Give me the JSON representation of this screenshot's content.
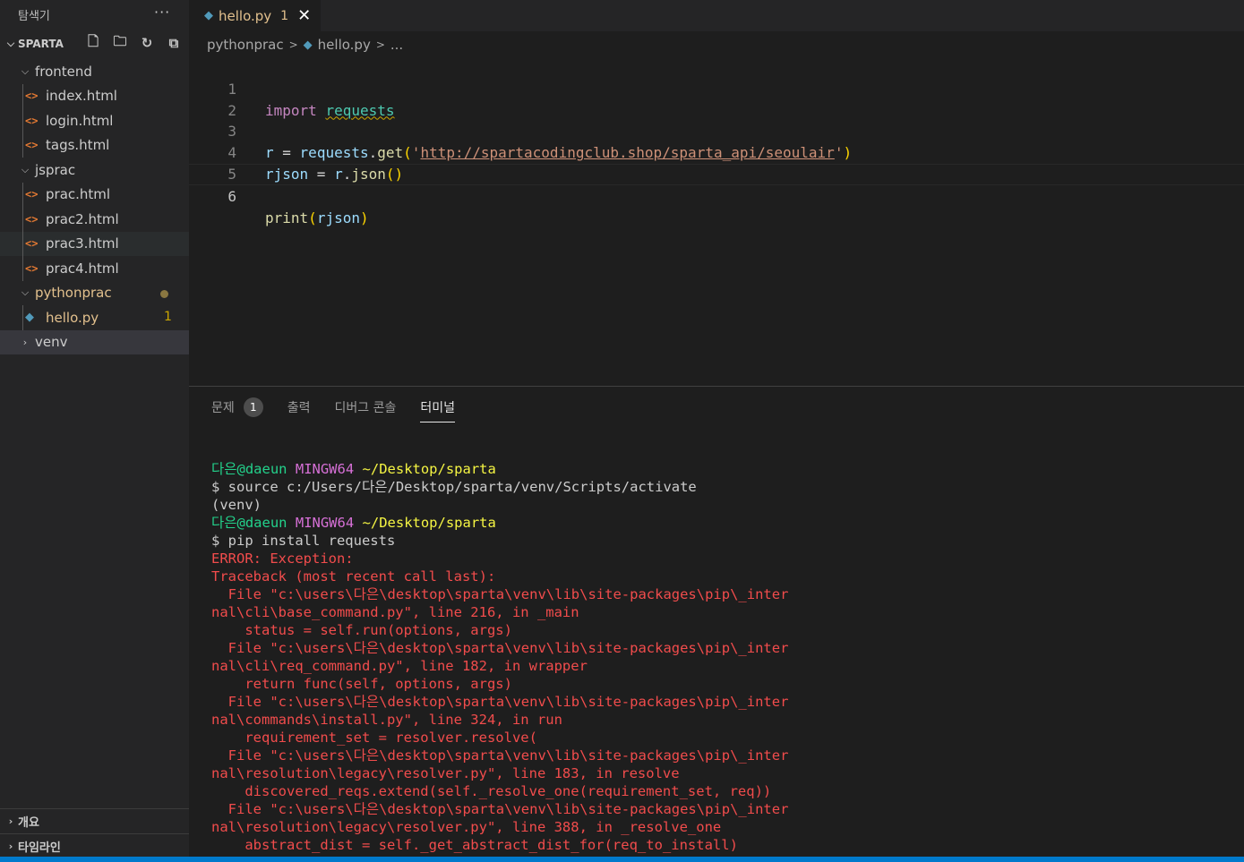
{
  "sidebar": {
    "title": "탐색기",
    "more_icon": "···",
    "workspace": "SPARTA",
    "actions": [
      "new-file-icon",
      "new-folder-icon",
      "refresh-icon",
      "collapse-all-icon"
    ],
    "tree": [
      {
        "label": "frontend",
        "type": "folder"
      },
      {
        "label": "index.html",
        "type": "html"
      },
      {
        "label": "login.html",
        "type": "html"
      },
      {
        "label": "tags.html",
        "type": "html"
      },
      {
        "label": "jsprac",
        "type": "folder"
      },
      {
        "label": "prac.html",
        "type": "html"
      },
      {
        "label": "prac2.html",
        "type": "html"
      },
      {
        "label": "prac3.html",
        "type": "html"
      },
      {
        "label": "prac4.html",
        "type": "html"
      },
      {
        "label": "pythonprac",
        "type": "folder"
      },
      {
        "label": "hello.py",
        "type": "python",
        "problems": "1"
      },
      {
        "label": "venv",
        "type": "folder-collapsed"
      }
    ],
    "outline": "개요",
    "timeline": "타임라인"
  },
  "editor": {
    "tab": {
      "name": "hello.py",
      "problems": "1",
      "close": "✕"
    },
    "breadcrumb": {
      "folder": "pythonprac",
      "file": "hello.py",
      "rest": "..."
    },
    "lines": {
      "n1": "1",
      "n2": "2",
      "n3": "3",
      "n4": "4",
      "n5": "5",
      "n6": "6",
      "l1_kw": "import",
      "l1_mod": "requests",
      "l3_var": "r",
      "l3_eq": " = ",
      "l3_obj": "requests",
      "l3_dot": ".",
      "l3_fn": "get",
      "l3_open": "(",
      "l3_q1": "'",
      "l3_url": "http://spartacodingclub.shop/sparta_api/seoulair",
      "l3_q2": "'",
      "l3_close": ")",
      "l4_var": "rjson",
      "l4_eq": " = ",
      "l4_obj": "r",
      "l4_dot": ".",
      "l4_fn": "json",
      "l4_parens": "()",
      "l6_fn": "print",
      "l6_open": "(",
      "l6_arg": "rjson",
      "l6_close": ")"
    }
  },
  "panel": {
    "tabs": {
      "problems": "문제",
      "problems_count": "1",
      "output": "출력",
      "debug": "디버그 콘솔",
      "terminal": "터미널"
    },
    "terminal": {
      "user1": "다은@daeun",
      "mingw1": "MINGW64",
      "path1": "~/Desktop/sparta",
      "cmd1": "$ source c:/Users/다은/Desktop/sparta/venv/Scripts/activate",
      "venv": "(venv)",
      "user2": "다은@daeun",
      "mingw2": "MINGW64",
      "path2": "~/Desktop/sparta",
      "cmd2": "$ pip install requests",
      "errors": [
        "ERROR: Exception:",
        "Traceback (most recent call last):",
        "  File \"c:\\users\\다은\\desktop\\sparta\\venv\\lib\\site-packages\\pip\\_inter",
        "nal\\cli\\base_command.py\", line 216, in _main",
        "    status = self.run(options, args)",
        "  File \"c:\\users\\다은\\desktop\\sparta\\venv\\lib\\site-packages\\pip\\_inter",
        "nal\\cli\\req_command.py\", line 182, in wrapper",
        "    return func(self, options, args)",
        "  File \"c:\\users\\다은\\desktop\\sparta\\venv\\lib\\site-packages\\pip\\_inter",
        "nal\\commands\\install.py\", line 324, in run",
        "    requirement_set = resolver.resolve(",
        "  File \"c:\\users\\다은\\desktop\\sparta\\venv\\lib\\site-packages\\pip\\_inter",
        "nal\\resolution\\legacy\\resolver.py\", line 183, in resolve",
        "    discovered_reqs.extend(self._resolve_one(requirement_set, req))",
        "  File \"c:\\users\\다은\\desktop\\sparta\\venv\\lib\\site-packages\\pip\\_inter",
        "nal\\resolution\\legacy\\resolver.py\", line 388, in _resolve_one",
        "    abstract_dist = self._get_abstract_dist_for(req_to_install)"
      ]
    }
  },
  "colors": {
    "accent": "#007acc",
    "error": "#f14c4c",
    "modified": "#e2c08d"
  }
}
